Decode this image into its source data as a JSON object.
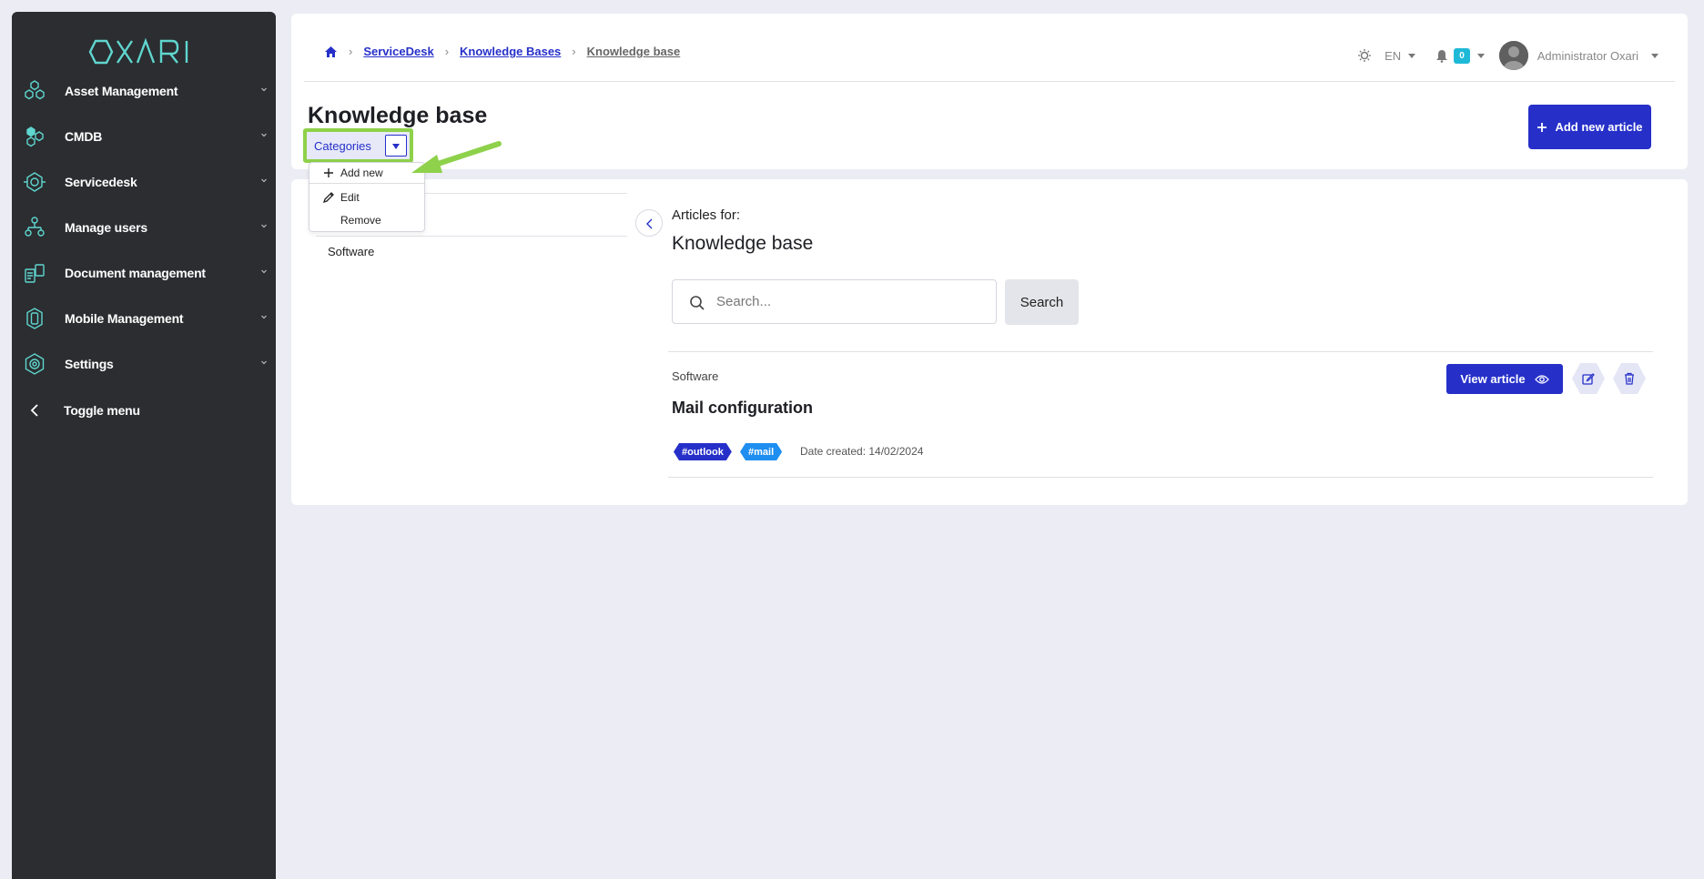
{
  "app": {
    "logo_text": "OXARI"
  },
  "sidebar": {
    "items": [
      {
        "label": "Asset Management",
        "icon": "hexagons-icon"
      },
      {
        "label": "CMDB",
        "icon": "cmdb-icon"
      },
      {
        "label": "Servicedesk",
        "icon": "servicedesk-icon"
      },
      {
        "label": "Manage users",
        "icon": "users-tree-icon"
      },
      {
        "label": "Document management",
        "icon": "documents-icon"
      },
      {
        "label": "Mobile Management",
        "icon": "mobile-icon"
      },
      {
        "label": "Settings",
        "icon": "gear-icon"
      }
    ],
    "toggle_label": "Toggle menu"
  },
  "breadcrumb": {
    "items": [
      "ServiceDesk",
      "Knowledge Bases"
    ],
    "current": "Knowledge base"
  },
  "topbar": {
    "language": "EN",
    "notification_count": "0",
    "user_name": "Administrator Oxari"
  },
  "page": {
    "title": "Knowledge base",
    "add_article_label": "Add new article"
  },
  "categories_menu": {
    "button_label": "Categories",
    "items": [
      "Add new",
      "Edit",
      "Remove"
    ]
  },
  "category_list": [
    "Software"
  ],
  "articles": {
    "heading": "Articles for:",
    "title": "Knowledge base",
    "search_placeholder": "Search...",
    "search_button": "Search",
    "rows": [
      {
        "category": "Software",
        "title": "Mail configuration",
        "tags": [
          "#outlook",
          "#mail"
        ],
        "date_created": "Date created: 14/02/2024",
        "view_label": "View article"
      }
    ]
  },
  "colors": {
    "accent": "#2630c9",
    "sidebar_bg": "#2b2d30",
    "logo": "#5fd6cf",
    "highlight": "#8ed14a",
    "badge": "#1fb9d8",
    "tag_secondary": "#1e8ef0"
  }
}
